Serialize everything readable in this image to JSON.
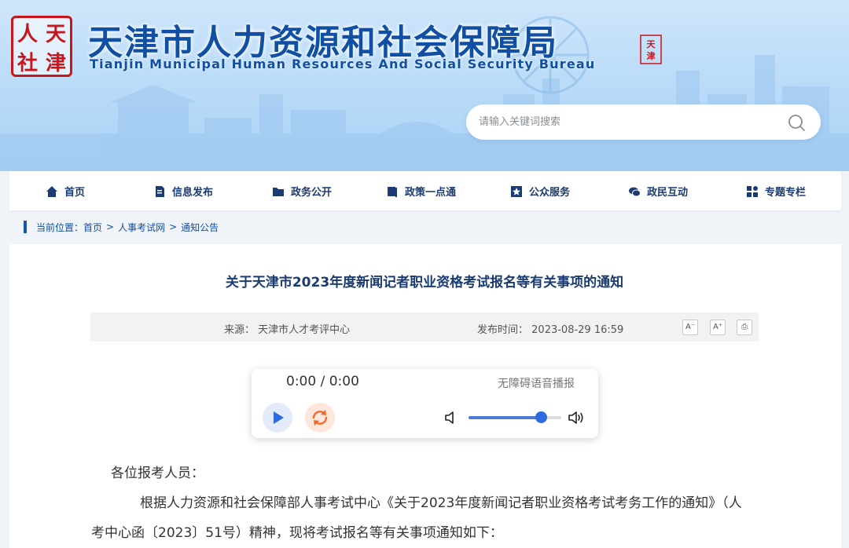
{
  "header": {
    "logo_chars": [
      "人",
      "天",
      "社",
      "津"
    ],
    "title": "天津市人力资源和社会保障局",
    "title_en": "Tianjin Municipal Human Resources And Social Security Bureau",
    "search_placeholder": "请输入关键词搜索",
    "search_icon": "search-icon"
  },
  "nav": [
    {
      "label": "首页",
      "icon": "home-icon"
    },
    {
      "label": "信息发布",
      "icon": "document-icon"
    },
    {
      "label": "政务公开",
      "icon": "folder-icon"
    },
    {
      "label": "政策一点通",
      "icon": "book-icon"
    },
    {
      "label": "公众服务",
      "icon": "star-badge-icon"
    },
    {
      "label": "政民互动",
      "icon": "chat-icon"
    },
    {
      "label": "专题专栏",
      "icon": "grid-icon"
    }
  ],
  "breadcrumb": {
    "prefix": "当前位置：",
    "items": [
      "首页",
      "人事考试网",
      "通知公告"
    ],
    "separator": ">"
  },
  "article": {
    "title": "关于天津市2023年度新闻记者职业资格考试报名等有关事项的通知",
    "source_label": "来源：",
    "source": "天津市人才考评中心",
    "time_label": "发布时间：",
    "time": "2023-08-29 16:59",
    "tools": [
      {
        "label": "A⁻",
        "icon": "font-decrease-icon"
      },
      {
        "label": "A⁺",
        "icon": "font-increase-icon"
      },
      {
        "label": "⎙",
        "icon": "print-icon"
      }
    ],
    "salutation": "各位报考人员：",
    "paragraph": "根据人力资源和社会保障部人事考试中心《关于2023年度新闻记者职业资格考试考务工作的通知》（人考中心函〔2023〕51号）精神，现将考试报名等有关事项通知如下："
  },
  "player": {
    "time": "0:00 / 0:00",
    "label": "无障碍语音播报",
    "volume": 0.78,
    "colors": {
      "accent": "#2f6be0",
      "loop": "#f0662a"
    }
  },
  "colors": {
    "brand": "#114fa4",
    "nav_text": "#1a3b73",
    "seal": "#c8161d"
  }
}
